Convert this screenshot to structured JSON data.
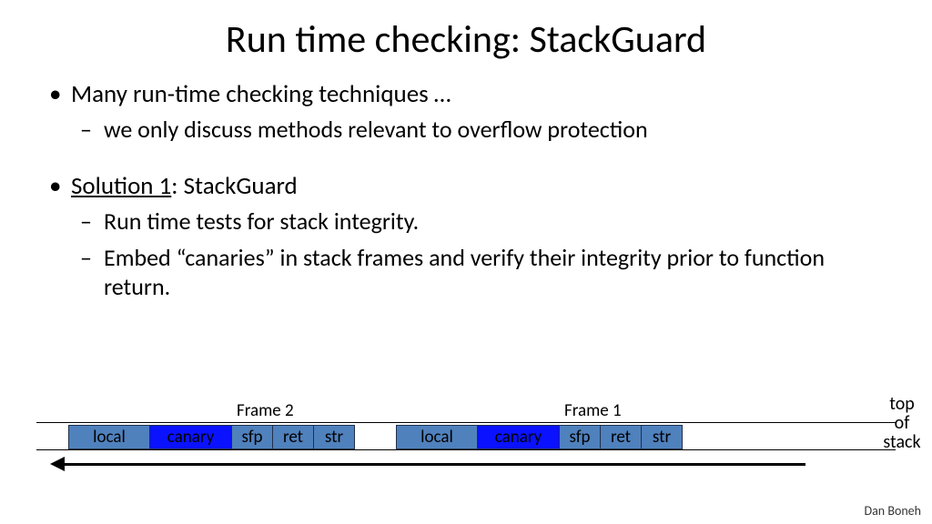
{
  "title": "Run time checking: StackGuard",
  "bullets": {
    "b1": "Many run-time checking techniques …",
    "b1a": "we only discuss methods relevant to overflow protection",
    "b2_prefix": "Solution 1",
    "b2_rest": ":  StackGuard",
    "b2a": "Run time tests for stack integrity.",
    "b2b": "Embed “canaries” in stack frames and verify their integrity prior to function return."
  },
  "diagram": {
    "frame2_label": "Frame 2",
    "frame1_label": "Frame 1",
    "cells": {
      "local": "local",
      "canary": "canary",
      "sfp": "sfp",
      "ret": "ret",
      "str": "str"
    },
    "top_of_stack_l1": "top",
    "top_of_stack_l2": "of",
    "top_of_stack_l3": "stack"
  },
  "author": "Dan Boneh"
}
